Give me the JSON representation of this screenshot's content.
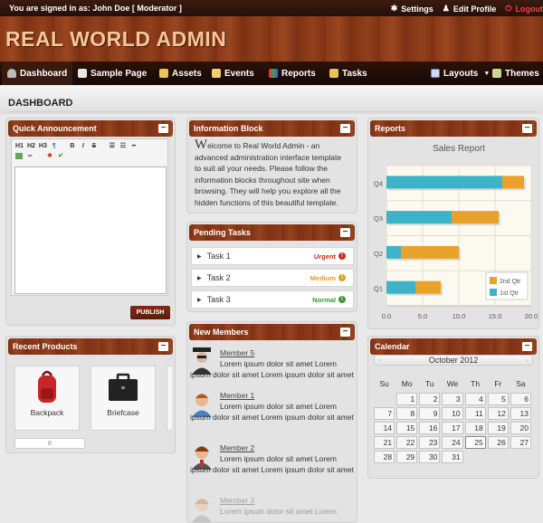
{
  "topbar": {
    "signed_in": "You are signed in as: John Doe [ Moderator ]",
    "settings": "Settings",
    "edit_profile": "Edit Profile",
    "logout": "Logout"
  },
  "header": {
    "logo": "REAL WORLD ADMIN"
  },
  "nav": {
    "items": [
      {
        "label": "Dashboard",
        "icon": "dashboard-icon"
      },
      {
        "label": "Sample Page",
        "icon": "page-icon"
      },
      {
        "label": "Assets",
        "icon": "folder-icon"
      },
      {
        "label": "Events",
        "icon": "calendar-icon"
      },
      {
        "label": "Reports",
        "icon": "chart-icon"
      },
      {
        "label": "Tasks",
        "icon": "folder-icon"
      }
    ],
    "right": [
      {
        "label": "Layouts",
        "icon": "layouts-icon"
      },
      {
        "label": "Themes",
        "icon": "themes-icon"
      }
    ]
  },
  "page": {
    "title": "DASHBOARD"
  },
  "announcement": {
    "title": "Quick Announcement",
    "toolbar": [
      "H1",
      "H2",
      "H3",
      "¶",
      "B",
      "I",
      "S"
    ],
    "publish": "PUBLISH"
  },
  "info": {
    "title": "Information Block",
    "first_letter": "W",
    "text": "elcome to Real World Admin - an advanced administration interface template to suit all your needs. Please follow the information blocks throughout site when browsing. They will help you explore all the hidden functions of this beautiful template."
  },
  "tasks": {
    "title": "Pending Tasks",
    "items": [
      {
        "label": "Task 1",
        "priority": "Urgent",
        "color": "#cc2b1f"
      },
      {
        "label": "Task 2",
        "priority": "Medium",
        "color": "#e0a020"
      },
      {
        "label": "Task 3",
        "priority": "Normal",
        "color": "#3a9a2c"
      }
    ]
  },
  "members": {
    "title": "New Members",
    "items": [
      {
        "name": "Member 5",
        "desc": "Lorem ipsum dolor sit amet Lorem ipsum dolor sit amet Lorem ipsum dolor sit amet"
      },
      {
        "name": "Member 1",
        "desc": "Lorem ipsum dolor sit amet Lorem ipsum dolor sit amet Lorem ipsum dolor sit amet"
      },
      {
        "name": "Member 2",
        "desc": "Lorem ipsum dolor sit amet Lorem ipsum dolor sit amet Lorem ipsum dolor sit amet"
      },
      {
        "name": "Member 3",
        "desc": "Lorem ipsum dolor sit amet Lorem"
      }
    ]
  },
  "products": {
    "title": "Recent Products",
    "items": [
      {
        "label": "Backpack"
      },
      {
        "label": "Briefcase"
      }
    ],
    "scroll_label": "II"
  },
  "reports": {
    "title": "Reports"
  },
  "calendar": {
    "title": "Calendar",
    "month": "October 2012",
    "days": [
      "Su",
      "Mo",
      "Tu",
      "We",
      "Th",
      "Fr",
      "Sa"
    ],
    "weeks": [
      [
        "",
        "1",
        "2",
        "3",
        "4",
        "5",
        "6"
      ],
      [
        "7",
        "8",
        "9",
        "10",
        "11",
        "12",
        "13"
      ],
      [
        "14",
        "15",
        "16",
        "17",
        "18",
        "19",
        "20"
      ],
      [
        "21",
        "22",
        "23",
        "24",
        "25",
        "26",
        "27"
      ],
      [
        "28",
        "29",
        "30",
        "31",
        "",
        "",
        ""
      ]
    ],
    "today": "25"
  },
  "chart_data": {
    "type": "bar",
    "orientation": "horizontal",
    "stacked": true,
    "title": "Sales Report",
    "categories": [
      "Q1",
      "Q2",
      "Q3",
      "Q4"
    ],
    "series": [
      {
        "name": "1st Qtr",
        "values": [
          4,
          2,
          9,
          16
        ],
        "color": "#3db3c8"
      },
      {
        "name": "2nd Qtr",
        "values": [
          3.5,
          8,
          6.5,
          3
        ],
        "color": "#e8a22a"
      }
    ],
    "xlim": [
      0,
      20
    ],
    "xticks": [
      "0.0",
      "5.0",
      "10.0",
      "15.0",
      "20.0"
    ],
    "grid": true,
    "legend": "bottom-right"
  }
}
